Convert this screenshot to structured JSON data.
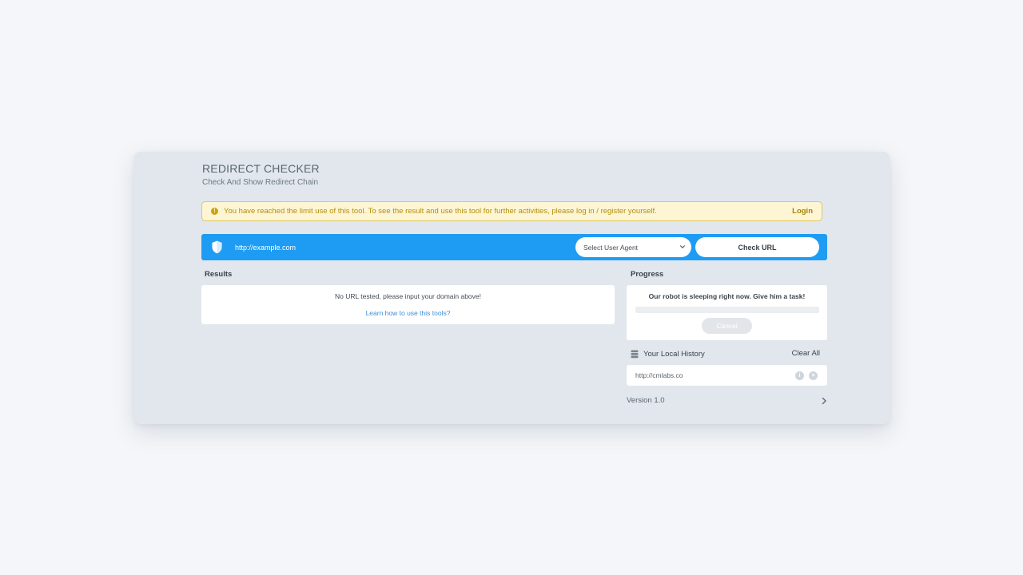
{
  "header": {
    "title": "REDIRECT CHECKER",
    "subtitle": "Check And Show Redirect Chain"
  },
  "alert": {
    "icon": "info-icon",
    "icon_glyph": "!",
    "message": "You have reached the limit use of this tool. To see the result and use this tool for further activities, please log in / register yourself.",
    "login_label": "Login"
  },
  "search_bar": {
    "shield_icon": "shield-icon",
    "url_value": "http://example.com",
    "user_agent_selected": "Select User Agent",
    "check_button_label": "Check URL"
  },
  "results": {
    "label": "Results",
    "empty_message": "No URL tested, please input your domain above!",
    "help_link": "Learn how to use this tools?"
  },
  "progress": {
    "label": "Progress",
    "status_message": "Our robot is sleeping right now. Give him a task!",
    "percent": 0,
    "cancel_label": "Cancel"
  },
  "history": {
    "icon": "database-icon",
    "title": "Your Local History",
    "clear_label": "Clear All",
    "items": [
      {
        "url": "http://cmlabs.co",
        "info_icon": "info-icon",
        "info_glyph": "i",
        "remove_icon": "close-icon",
        "remove_glyph": "×"
      }
    ]
  },
  "footer": {
    "version_label": "Version 1.0",
    "chevron_icon": "chevron-right-icon"
  },
  "colors": {
    "page_bg": "#f4f6f9",
    "card_bg": "#e1e7ed",
    "primary": "#1e9cf3",
    "alert_bg": "#fdf5d3",
    "alert_border": "#e0c862",
    "alert_text": "#b3900c",
    "link": "#3a8fd6"
  }
}
